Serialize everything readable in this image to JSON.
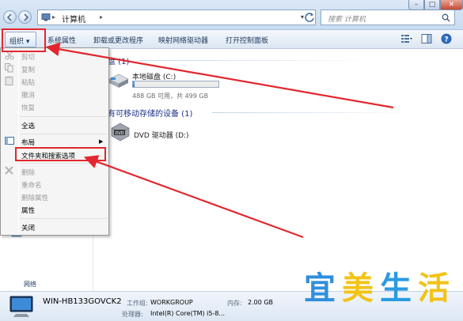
{
  "address_bar": {
    "path": "计算机",
    "search_placeholder": "搜索 计算机"
  },
  "window_controls": {
    "minimize": "–",
    "maximize": "□",
    "close": "✕"
  },
  "toolbar": {
    "organize": "组织 ▾",
    "system_properties": "系统属性",
    "uninstall": "卸载或更改程序",
    "map_drive": "映射网络驱动器",
    "control_panel": "打开控制面板"
  },
  "groups": {
    "hard_disks": "盘 (1)",
    "removable": "有可移动存储的设备 (1)"
  },
  "drive_c": {
    "name": "本地磁盘 (C:)",
    "free_text": "488 GB 可用，共 499 GB",
    "used_fraction": 0.022
  },
  "drive_dvd": {
    "name": "DVD 驱动器 (D:)",
    "icon_label": "DVD"
  },
  "context_menu": {
    "cut": "剪切",
    "copy": "复制",
    "paste": "粘贴",
    "undo": "撤消",
    "redo": "恢复",
    "select_all": "全选",
    "layout": "布局",
    "folder_options": "文件夹和搜索选项",
    "delete": "删除",
    "rename": "重命名",
    "remove_properties": "删除属性",
    "properties": "属性",
    "close": "关闭"
  },
  "nav_pane": {
    "network": "网络"
  },
  "details": {
    "computer_name": "WIN-HB133GOVCK2",
    "workgroup_label": "工作组:",
    "workgroup": "WORKGROUP",
    "memory_label": "内存:",
    "memory": "2.00 GB",
    "processor_label": "处理器:",
    "processor": "Intel(R) Core(TM) i5-8..."
  },
  "watermark": {
    "chars": [
      "宜",
      "美",
      "生",
      "活"
    ],
    "colors": [
      "#2f8fdc",
      "#f2c318",
      "#2a9be0",
      "#f2c318"
    ]
  },
  "annotation": {
    "color": "#e3262e"
  }
}
